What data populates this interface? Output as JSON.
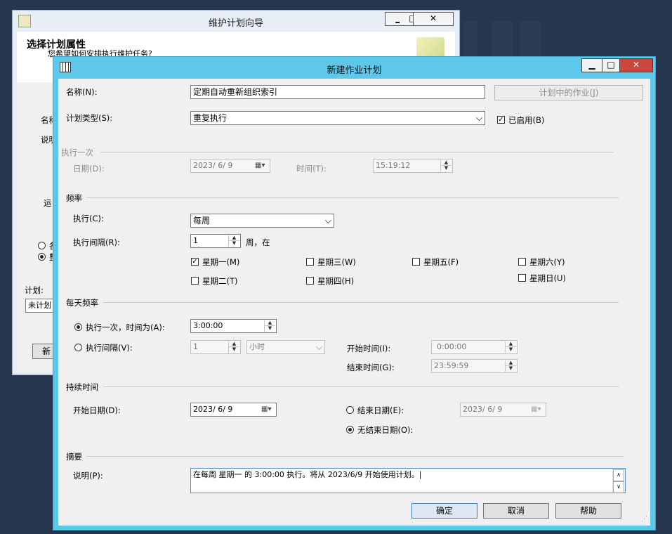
{
  "wizard": {
    "title": "维护计划向导",
    "header_title": "选择计划属性",
    "header_subtitle": "您希望如何安排执行维护任务?",
    "frag_name": "名称",
    "frag_desc": "说明",
    "frag_run": "运",
    "frag_opt1": "各",
    "frag_opt2": "整",
    "schedule_label": "计划:",
    "schedule_value": "未计划",
    "frag_btn": "新",
    "min": "▁",
    "max": "□",
    "close": "✕"
  },
  "dialog": {
    "title": "新建作业计划",
    "min": "▁",
    "max": "□",
    "close": "✕",
    "name_label": "名称(N):",
    "name_value": "定期自动重新组织索引",
    "jobs_button": "计划中的作业(J)",
    "type_label": "计划类型(S):",
    "type_value": "重复执行",
    "enabled_label": "已启用(B)",
    "enabled_checked": true,
    "once": {
      "group": "执行一次",
      "date_label": "日期(D):",
      "date_value": "2023/ 6/ 9",
      "time_label": "时间(T):",
      "time_value": "15:19:12"
    },
    "frequency": {
      "group": "频率",
      "occurs_label": "执行(C):",
      "occurs_value": "每周",
      "interval_label": "执行间隔(R):",
      "interval_value": "1",
      "interval_unit": "周，在",
      "days": [
        {
          "label": "星期一(M)",
          "checked": true
        },
        {
          "label": "星期二(T)",
          "checked": false
        },
        {
          "label": "星期三(W)",
          "checked": false
        },
        {
          "label": "星期四(H)",
          "checked": false
        },
        {
          "label": "星期五(F)",
          "checked": false
        },
        {
          "label": "星期六(Y)",
          "checked": false
        },
        {
          "label": "星期日(U)",
          "checked": false
        }
      ]
    },
    "daily": {
      "group": "每天频率",
      "once_label": "执行一次，时间为(A):",
      "once_value": "3:00:00",
      "every_label": "执行间隔(V):",
      "every_value": "1",
      "every_unit": "小时",
      "start_label": "开始时间(I):",
      "start_value": "0:00:00",
      "end_label": "结束时间(G):",
      "end_value": "23:59:59"
    },
    "duration": {
      "group": "持续时间",
      "start_label": "开始日期(D):",
      "start_value": "2023/ 6/ 9",
      "end_label": "结束日期(E):",
      "end_value": "2023/ 6/ 9",
      "noend_label": "无结束日期(O):"
    },
    "summary": {
      "group": "摘要",
      "desc_label": "说明(P):",
      "desc_value": "在每周 星期一 的 3:00:00 执行。将从 2023/6/9 开始使用计划。|"
    },
    "buttons": {
      "ok": "确定",
      "cancel": "取消",
      "help": "帮助"
    }
  }
}
